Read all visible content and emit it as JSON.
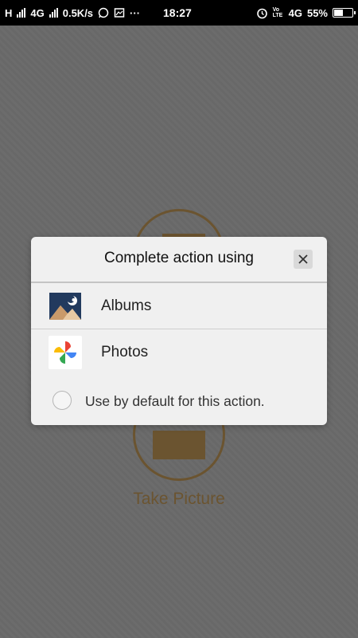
{
  "status_bar": {
    "left_text_1": "H",
    "left_text_2": "4G",
    "speed": "0.5K/s",
    "dots": "···",
    "time": "18:27",
    "volte": "Vo LTE",
    "network": "4G",
    "battery": "55%",
    "battery_level": 0.55
  },
  "background_app": {
    "take_picture_label": "Take Picture"
  },
  "dialog": {
    "title": "Complete action using",
    "options": [
      {
        "label": "Albums",
        "icon": "albums-app-icon"
      },
      {
        "label": "Photos",
        "icon": "google-photos-icon"
      }
    ],
    "default_label": "Use by default for this action."
  },
  "colors": {
    "scrim": "#6b6b6b",
    "accent_brown": "#6b5430",
    "dialog_bg": "#f0f0f0"
  }
}
